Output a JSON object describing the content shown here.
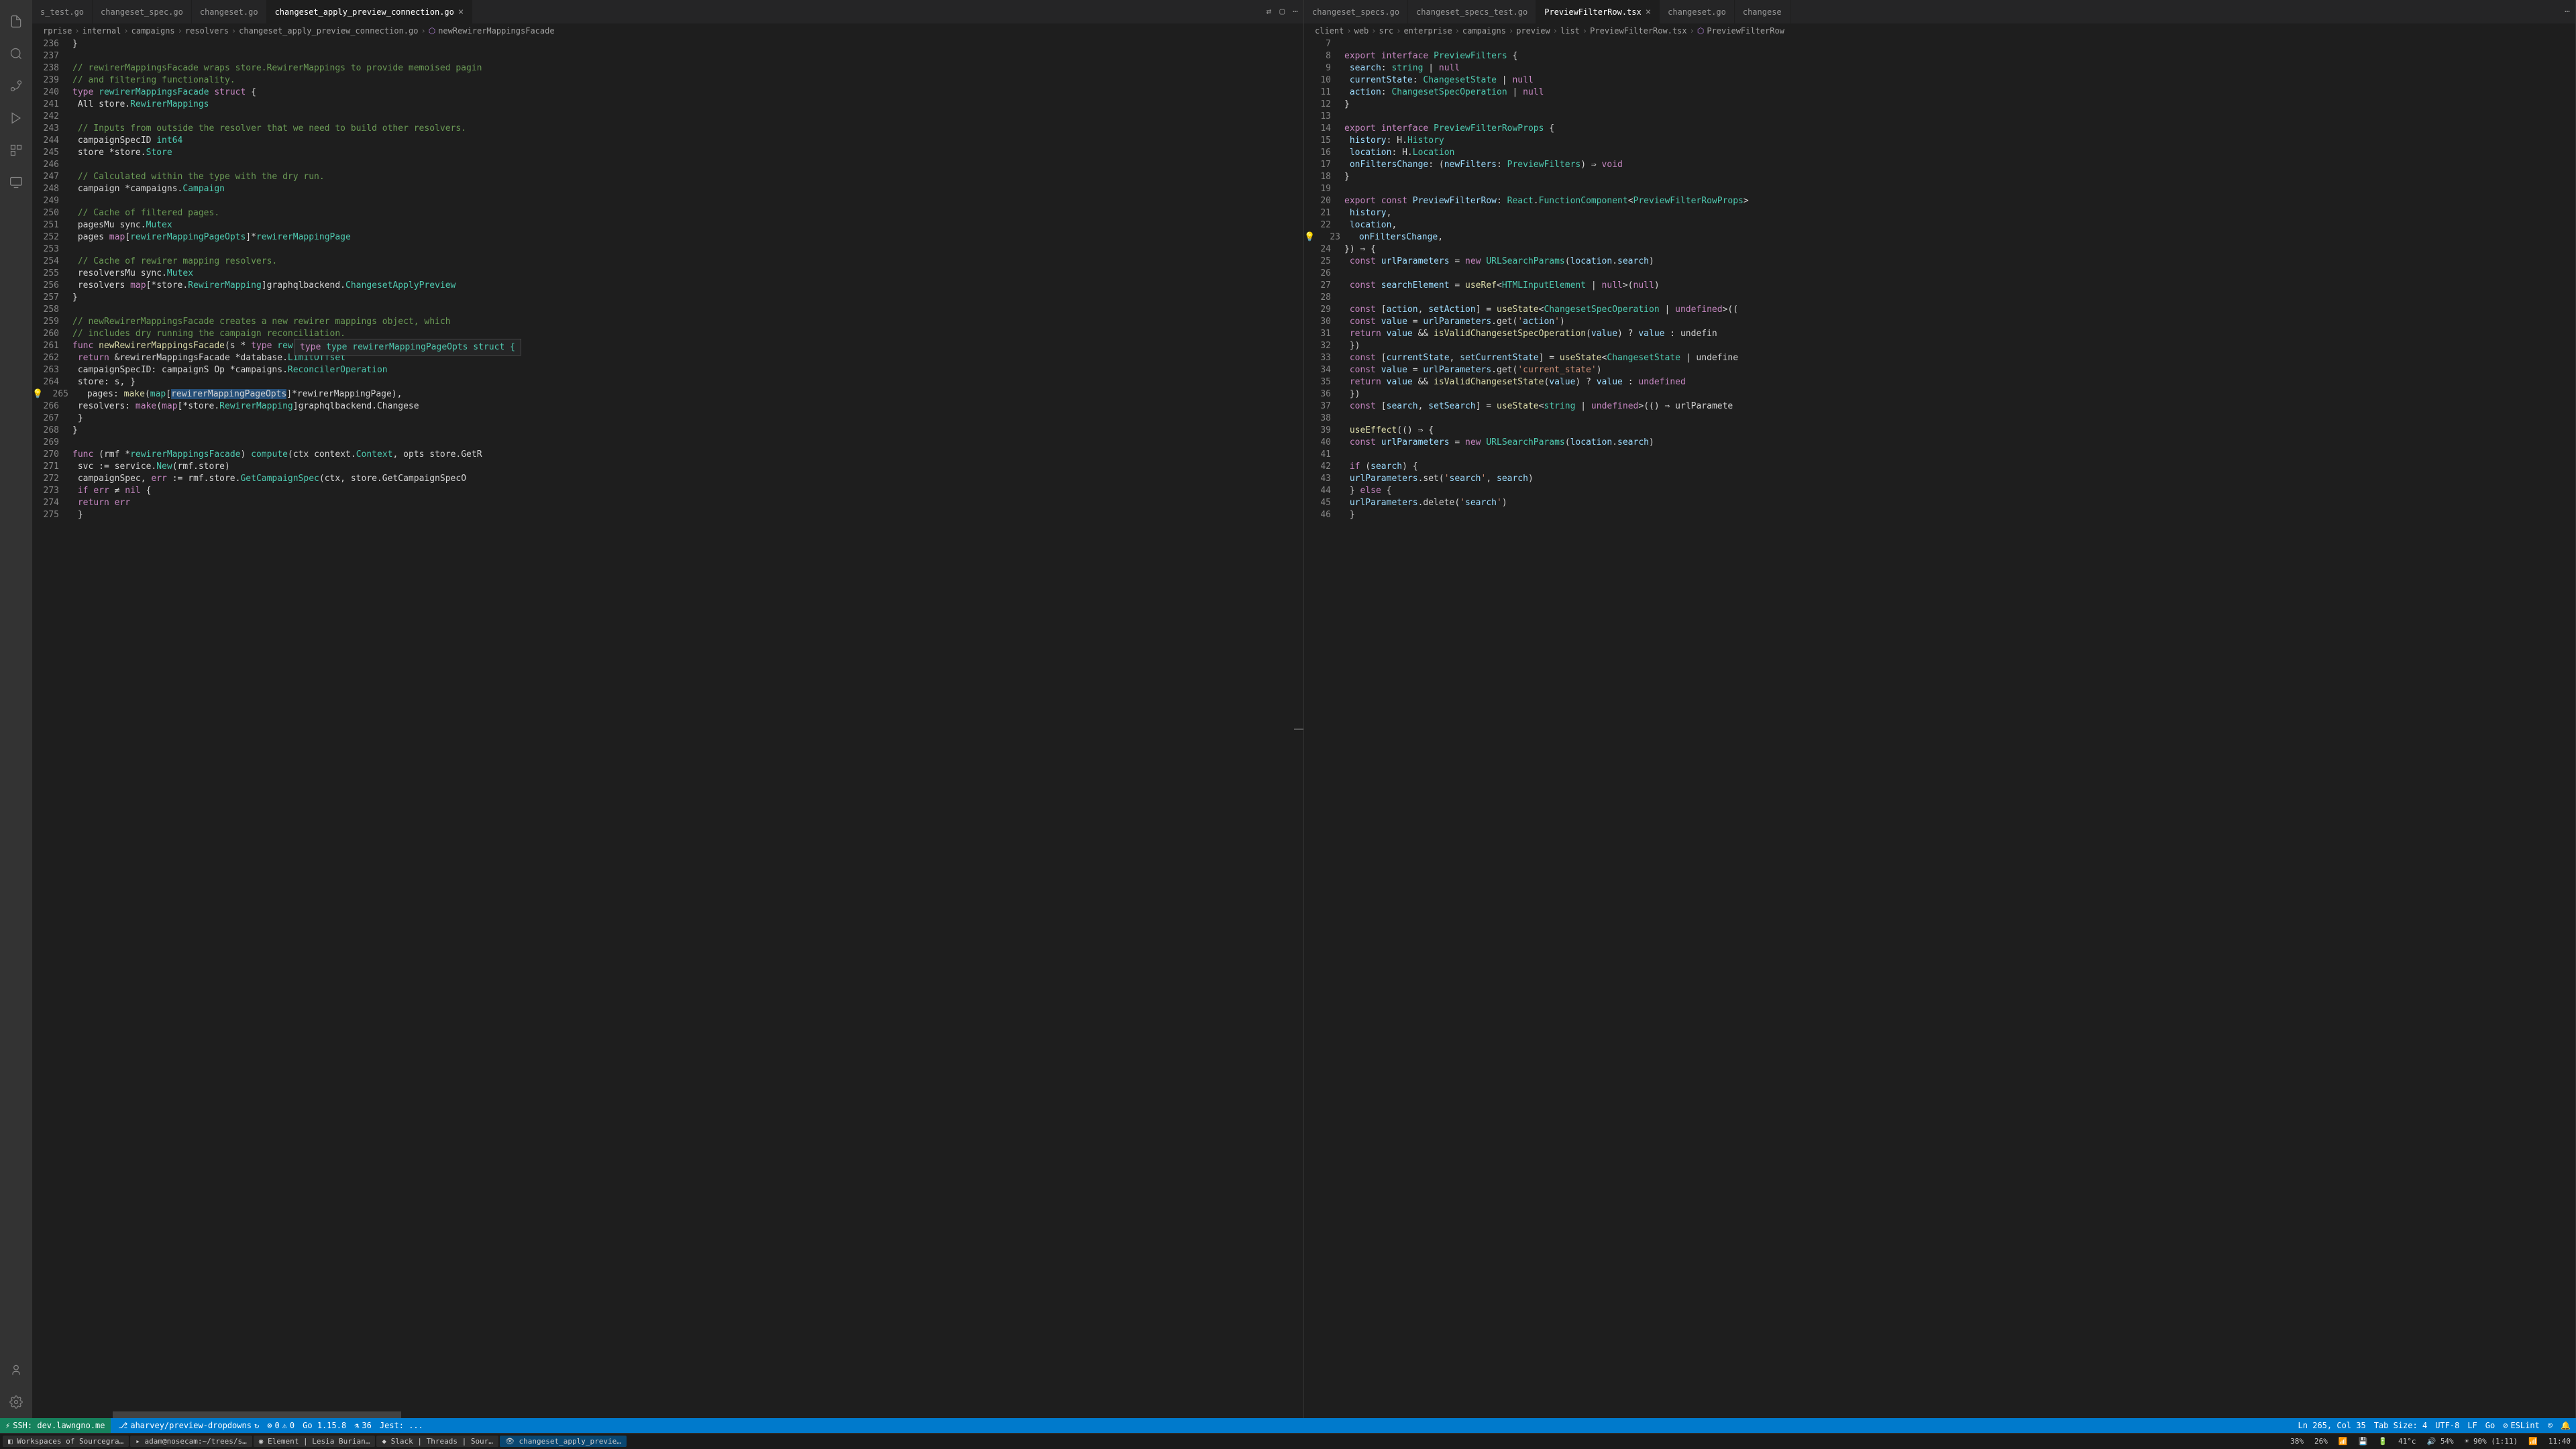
{
  "activityBar": {
    "icons": [
      "files",
      "search",
      "source-control",
      "run-debug",
      "extensions",
      "remote"
    ]
  },
  "leftEditor": {
    "tabs": [
      {
        "label": "s_test.go",
        "active": false
      },
      {
        "label": "changeset_spec.go",
        "active": false
      },
      {
        "label": "changeset.go",
        "active": false
      },
      {
        "label": "changeset_apply_preview_connection.go",
        "active": true
      }
    ],
    "breadcrumb": [
      "rprise",
      "internal",
      "campaigns",
      "resolvers",
      "changeset_apply_preview_connection.go",
      "newRewirerMappingsFacade"
    ],
    "startLine": 236,
    "lines": [
      "}",
      "",
      "// rewirerMappingsFacade wraps store.RewirerMappings to provide memoised pagin",
      "// and filtering functionality.",
      "type rewirerMappingsFacade struct {",
      "    All store.RewirerMappings",
      "",
      "    // Inputs from outside the resolver that we need to build other resolvers.",
      "    campaignSpecID int64",
      "    store          *store.Store",
      "",
      "    // Calculated within the type with the dry run.",
      "    campaign *campaigns.Campaign",
      "",
      "    // Cache of filtered pages.",
      "    pagesMu sync.Mutex",
      "    pages   map[rewirerMappingPageOpts]*rewirerMappingPage",
      "",
      "    // Cache of rewirer mapping resolvers.",
      "    resolversMu sync.Mutex",
      "    resolvers   map[*store.RewirerMapping]graphqlbackend.ChangesetApplyPreview",
      "}",
      "",
      "// newRewirerMappingsFacade creates a new rewirer mappings object, which",
      "// includes dry running the campaign reconciliation.",
      "func newRewirerMappingsFacade(s *",
      "    return &rewirerMappingsFacade",
      "        campaignSpecID: campaignS",
      "        store:          s,",
      "        pages:          make(map[rewirerMappingPageOpts]*rewirerMappingPage),",
      "        resolvers:      make(map[*store.RewirerMapping]graphqlbackend.Changese",
      "    }",
      "}",
      "",
      "func (rmf *rewirerMappingsFacade) compute(ctx context.Context, opts store.GetR",
      "    svc := service.New(rmf.store)",
      "    campaignSpec, err := rmf.store.GetCampaignSpec(ctx, store.GetCampaignSpecO",
      "    if err ≠ nil {",
      "        return err",
      "    }"
    ],
    "tooltip": {
      "line1": "type rewirerMappingPageOpts struct {",
      "line2": "    *database.LimitOffset",
      "line3": "    Op *campaigns.ReconcilerOperation",
      "line4": "}"
    }
  },
  "rightEditor": {
    "tabs": [
      {
        "label": "changeset_specs.go",
        "active": false
      },
      {
        "label": "changeset_specs_test.go",
        "active": false
      },
      {
        "label": "PreviewFilterRow.tsx",
        "active": true
      },
      {
        "label": "changeset.go",
        "active": false
      },
      {
        "label": "changese",
        "active": false
      }
    ],
    "breadcrumb": [
      "client",
      "web",
      "src",
      "enterprise",
      "campaigns",
      "preview",
      "list",
      "PreviewFilterRow.tsx",
      "PreviewFilterRow"
    ],
    "startLine": 7,
    "lines": [
      "",
      "export interface PreviewFilters {",
      "    search: string | null",
      "    currentState: ChangesetState | null",
      "    action: ChangesetSpecOperation | null",
      "}",
      "",
      "export interface PreviewFilterRowProps {",
      "    history: H.History",
      "    location: H.Location",
      "    onFiltersChange: (newFilters: PreviewFilters) ⇒ void",
      "}",
      "",
      "export const PreviewFilterRow: React.FunctionComponent<PreviewFilterRowProps>",
      "    history,",
      "    location,",
      "    onFiltersChange,",
      "}) ⇒ {",
      "    const urlParameters = new URLSearchParams(location.search)",
      "",
      "    const searchElement = useRef<HTMLInputElement | null>(null)",
      "",
      "    const [action, setAction] = useState<ChangesetSpecOperation | undefined>((",
      "        const value = urlParameters.get('action')",
      "        return value && isValidChangesetSpecOperation(value) ? value : undefin",
      "    })",
      "    const [currentState, setCurrentState] = useState<ChangesetState | undefine",
      "        const value = urlParameters.get('current_state')",
      "        return value && isValidChangesetState(value) ? value : undefined",
      "    })",
      "    const [search, setSearch] = useState<string | undefined>(() ⇒ urlParamete",
      "",
      "    useEffect(() ⇒ {",
      "        const urlParameters = new URLSearchParams(location.search)",
      "",
      "        if (search) {",
      "            urlParameters.set('search', search)",
      "        } else {",
      "            urlParameters.delete('search')",
      "        }"
    ]
  },
  "statusBar": {
    "remote": "SSH: dev.lawngno.me",
    "branch": "aharvey/preview-dropdowns",
    "errors": "0",
    "warnings": "0",
    "goVersion": "Go 1.15.8",
    "tests": "36",
    "jest": "Jest: ...",
    "cursor": "Ln 265, Col 35",
    "tabSize": "Tab Size: 4",
    "encoding": "UTF-8",
    "eol": "LF",
    "lang": "Go",
    "eslint": "ESLint",
    "bell": "bell-icon"
  },
  "taskbar": {
    "items": [
      "Workspaces of Sourcegra…",
      "adam@nosecam:~/trees/s…",
      "Element | Lesia Burian…",
      "Slack | Threads | Sour…",
      "changeset_apply_previe…"
    ],
    "activeIndex": 4,
    "stats": {
      "cpu1": "38%",
      "cpu2": "26%",
      "net": "↓",
      "disk": "⬤",
      "battery": "▬",
      "temp": "41°c",
      "vol": "54%",
      "brightness": "90% (1:11)",
      "time": "11:40"
    }
  }
}
